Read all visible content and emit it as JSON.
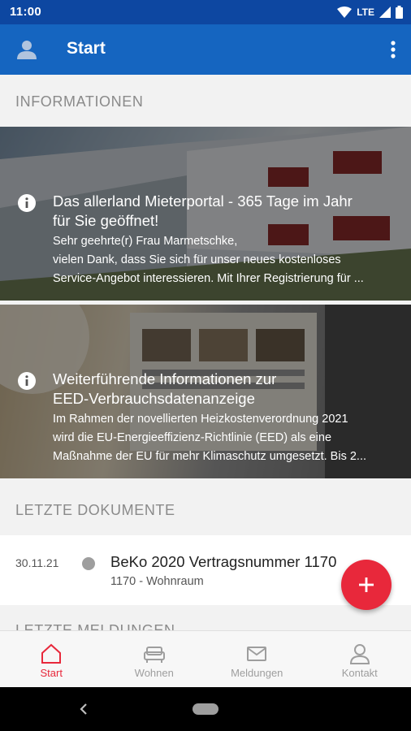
{
  "status_bar": {
    "time": "11:00",
    "network": "LTE"
  },
  "app_bar": {
    "title": "Start"
  },
  "sections": {
    "informationen": "INFORMATIONEN",
    "letzte_dokumente": "LETZTE DOKUMENTE",
    "letzte_meldungen": "LETZTE MELDUNGEN"
  },
  "info_cards": [
    {
      "title_line1": "Das allerland Mieterportal - 365 Tage im Jahr",
      "title_line2": "für Sie geöffnet!",
      "text_line1": "Sehr geehrte(r) Frau Marmetschke,",
      "text_line2": "vielen Dank, dass Sie sich für unser neues kostenloses",
      "text_line3": "Service-Angebot interessieren. Mit Ihrer Registrierung für ..."
    },
    {
      "title_line1": "Weiterführende Informationen zur",
      "title_line2": "EED-Verbrauchsdatenanzeige",
      "text_line1": "Im Rahmen der novellierten Heizkostenverordnung 2021",
      "text_line2": "wird die EU-Energieeffizienz-Richtlinie (EED) als eine",
      "text_line3": "Maßnahme der EU für mehr Klimaschutz umgesetzt. Bis 2..."
    }
  ],
  "documents": [
    {
      "date": "30.11.21",
      "title": "BeKo 2020 Vertragsnummer 1170",
      "subtitle": "1170 - Wohnraum"
    }
  ],
  "fab": {
    "icon": "plus-icon"
  },
  "bottom_nav": [
    {
      "label": "Start",
      "icon": "home-icon",
      "active": true
    },
    {
      "label": "Wohnen",
      "icon": "sofa-icon",
      "active": false
    },
    {
      "label": "Meldungen",
      "icon": "mail-icon",
      "active": false
    },
    {
      "label": "Kontakt",
      "icon": "person-icon",
      "active": false
    }
  ],
  "colors": {
    "primary": "#1565c0",
    "status_bar": "#0d47a1",
    "accent": "#e8283b",
    "inactive": "#9e9e9e"
  }
}
